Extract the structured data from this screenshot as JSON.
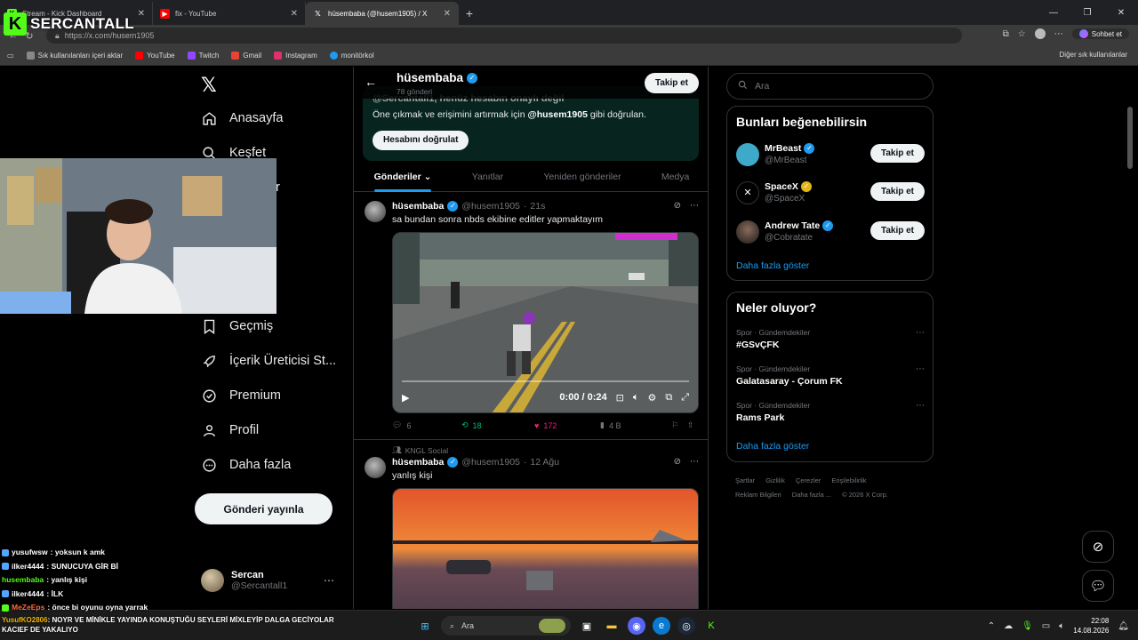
{
  "browser": {
    "tabs": [
      {
        "title": "Stream - Kick Dashboard",
        "fav": "K",
        "color": "#53fc18"
      },
      {
        "title": "fix - YouTube",
        "fav": "▶",
        "color": "#ff0000"
      },
      {
        "title": "hüsembaba (@husem1905) / X",
        "fav": "X",
        "color": "#000000",
        "active": true
      }
    ],
    "url": "https://x.com/husem1905",
    "copilot_label": "Sohbet et",
    "bookmarks": [
      {
        "label": "Sık kullanılanları içeri aktar",
        "color": "#888888"
      },
      {
        "label": "YouTube",
        "color": "#ff0000"
      },
      {
        "label": "Twitch",
        "color": "#9146ff"
      },
      {
        "label": "Gmail",
        "color": "#ea4335"
      },
      {
        "label": "Instagram",
        "color": "#e1306c"
      },
      {
        "label": "monitörkol",
        "color": "#1d9bf0"
      }
    ],
    "bookmarks_other": "Diğer sık kullanılanlar"
  },
  "overlay": {
    "logo_letter": "K",
    "logo_text": "SERCANTALL"
  },
  "leftnav": {
    "items": [
      {
        "label": "Anasayfa",
        "icon": "home-icon"
      },
      {
        "label": "Keşfet",
        "icon": "search-icon"
      },
      {
        "label": "er",
        "icon": "bell-icon"
      },
      {
        "label": "Geçmiş",
        "icon": "bookmark-icon"
      },
      {
        "label": "İçerik Üreticisi St...",
        "icon": "rocket-icon"
      },
      {
        "label": "Premium",
        "icon": "verified-icon"
      },
      {
        "label": "Profil",
        "icon": "person-icon"
      },
      {
        "label": "Daha fazla",
        "icon": "more-circle-icon"
      }
    ],
    "post_button": "Gönderi yayınla",
    "account": {
      "name": "Sercan",
      "handle": "@Sercantall1"
    }
  },
  "profile": {
    "name": "hüsembaba",
    "post_count": "78 gönderi",
    "follow_label": "Takip et",
    "verify_title": "@Sercantall1, henüz hesabın onaylı değil",
    "verify_text_pre": "Öne çıkmak ve erişimini artırmak için ",
    "verify_handle": "@husem1905",
    "verify_text_post": " gibi doğrulan.",
    "verify_button": "Hesabını doğrulat",
    "tabs": [
      "Gönderiler",
      "Yanıtlar",
      "Yeniden gönderiler",
      "Medya"
    ]
  },
  "tweets": [
    {
      "name": "hüsembaba",
      "handle": "@husem1905",
      "time": "21s",
      "text": "sa bundan sonra nbds ekibine editler yapmaktayım",
      "video_time": "0:00 / 0:24",
      "replies": "6",
      "reposts": "18",
      "likes": "172",
      "views": "4 B"
    },
    {
      "social": "KNGL Social",
      "name": "hüsembaba",
      "handle": "@husem1905",
      "time": "12 Ağu",
      "text": "yanlış kişi"
    }
  ],
  "right": {
    "search_placeholder": "Ara",
    "who_title": "Bunları beğenebilirsin",
    "who": [
      {
        "name": "MrBeast",
        "handle": "@MrBeast",
        "follow": "Takip et",
        "badge": "blue",
        "color": "#3fa9c9"
      },
      {
        "name": "SpaceX",
        "handle": "@SpaceX",
        "follow": "Takip et",
        "badge": "gold",
        "color": "#000000"
      },
      {
        "name": "Andrew Tate",
        "handle": "@Cobratate",
        "follow": "Takip et",
        "badge": "blue",
        "color": "#2a2a2a"
      }
    ],
    "show_more": "Daha fazla göster",
    "trends_title": "Neler oluyor?",
    "trends": [
      {
        "category": "Spor · Gündemdekiler",
        "topic": "#GSvÇFK"
      },
      {
        "category": "Spor · Gündemdekiler",
        "topic": "Galatasaray - Çorum FK"
      },
      {
        "category": "Spor · Gündemdekiler",
        "topic": "Rams Park"
      }
    ],
    "footer_1": [
      "Şartlar",
      "Gizlilik",
      "Çerezler",
      "Erişilebilirlik"
    ],
    "footer_2": [
      "Reklam Bilgileri",
      "Daha fazla ...",
      "© 2026 X Corp."
    ]
  },
  "chat": [
    {
      "user": "yusufwsw",
      "color": "#ffffff",
      "text": ": yoksun k amk"
    },
    {
      "user": "ilker4444",
      "color": "#ffffff",
      "text": ": SUNUCUYA GİR Bİ"
    },
    {
      "user": "husembaba",
      "color": "#53fc18",
      "text": ": yanlış kişi"
    },
    {
      "user": "ilker4444",
      "color": "#ffffff",
      "text": ": İLK"
    },
    {
      "user": "MeZeEps",
      "color": "#ff6b3d",
      "text": ": önce bi oyunu oyna yarrak"
    }
  ],
  "banner": {
    "user": "YusufKO2806",
    "text": ": NOYR VE MİNİKLE YAYINDA KONUŞTUĞU SEYLERİ MİXLEYİP DALGA GECİYOLAR KACIEF DE YAKALIYO"
  },
  "taskbar": {
    "search": "Ara",
    "time": "22:08",
    "date": "14.08.2026"
  }
}
